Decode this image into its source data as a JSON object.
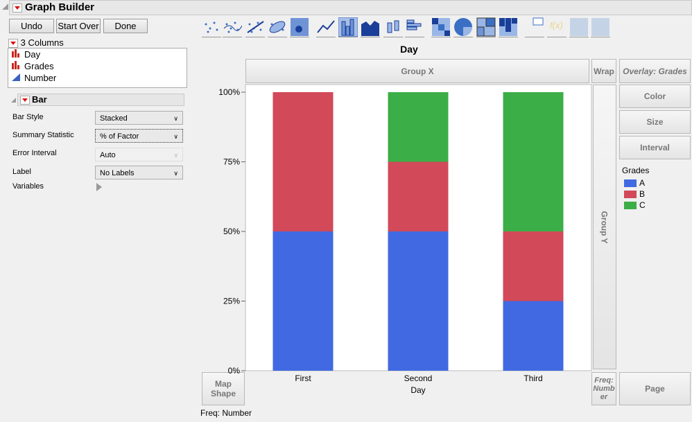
{
  "title": "Graph Builder",
  "buttons": {
    "undo": "Undo",
    "start_over": "Start Over",
    "done": "Done"
  },
  "columns": {
    "header": "3 Columns",
    "items": [
      {
        "name": "Day",
        "type": "nominal"
      },
      {
        "name": "Grades",
        "type": "nominal"
      },
      {
        "name": "Number",
        "type": "continuous"
      }
    ]
  },
  "bar_panel": {
    "title": "Bar",
    "rows": [
      {
        "label": "Bar Style",
        "value": "Stacked"
      },
      {
        "label": "Summary Statistic",
        "value": "% of Factor"
      },
      {
        "label": "Error Interval",
        "value": "Auto"
      },
      {
        "label": "Label",
        "value": "No Labels"
      }
    ],
    "variables": "Variables"
  },
  "toolbar": [
    "points",
    "contour-smoother",
    "line-of-fit",
    "ellipse",
    "contour",
    "line",
    "bar",
    "area",
    "box-plot",
    "histogram",
    "heatmap",
    "pie",
    "treemap",
    "mosaic",
    "caption-box",
    "formula",
    "map-shapes",
    "parallel"
  ],
  "zones": {
    "group_x": "Group X",
    "wrap": "Wrap",
    "overlay": "Overlay: Grades",
    "color": "Color",
    "size": "Size",
    "interval": "Interval",
    "group_y": "Group Y",
    "map_shape": "Map Shape",
    "freq": "Freq: Number",
    "page": "Page"
  },
  "footer": "Freq: Number",
  "legend": {
    "title": "Grades",
    "items": [
      {
        "label": "A",
        "color": "#4169e1"
      },
      {
        "label": "B",
        "color": "#d2495a"
      },
      {
        "label": "C",
        "color": "#3cae47"
      }
    ]
  },
  "chart_data": {
    "type": "bar",
    "stacked": true,
    "title": "Day",
    "xlabel": "Day",
    "ylabel": "",
    "categories": [
      "First",
      "Second",
      "Third"
    ],
    "series": [
      {
        "name": "A",
        "values": [
          50,
          50,
          25
        ]
      },
      {
        "name": "B",
        "values": [
          50,
          25,
          25
        ]
      },
      {
        "name": "C",
        "values": [
          0,
          25,
          50
        ]
      }
    ],
    "ylim": [
      0,
      100
    ],
    "yticks": [
      "0%",
      "25%",
      "50%",
      "75%",
      "100%"
    ],
    "grid": false,
    "legend": "right"
  }
}
